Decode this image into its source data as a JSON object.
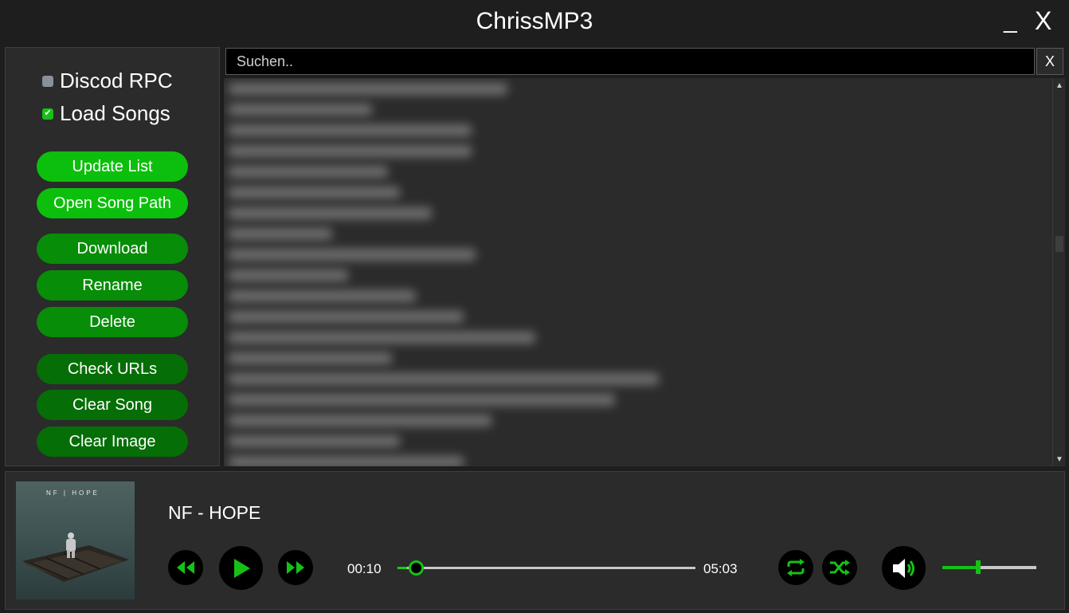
{
  "window": {
    "title": "ChrissMP3",
    "minimize_label": "_",
    "close_label": "X"
  },
  "sidebar": {
    "checkboxes": [
      {
        "label": "Discod RPC",
        "checked": false
      },
      {
        "label": "Load Songs",
        "checked": true
      }
    ],
    "buttons": [
      {
        "label": "Update List"
      },
      {
        "label": "Open Song Path"
      },
      {
        "label": "Download"
      },
      {
        "label": "Rename"
      },
      {
        "label": "Delete"
      },
      {
        "label": "Check URLs"
      },
      {
        "label": "Clear Song"
      },
      {
        "label": "Clear Image"
      }
    ]
  },
  "search": {
    "placeholder": "Suchen..",
    "value": "",
    "clear_label": "X"
  },
  "songlist": {
    "blurred": true,
    "visible_rows": 19
  },
  "player": {
    "song_title": "NF - HOPE",
    "cover_text": "NF | HOPE",
    "current_time": "00:10",
    "total_time": "05:03",
    "progress": 0.033,
    "volume": 0.38,
    "icons": {
      "previous": "rewind-icon",
      "play": "play-icon",
      "next": "fast-forward-icon",
      "repeat": "repeat-icon",
      "shuffle": "shuffle-icon",
      "volume": "speaker-icon"
    }
  },
  "colors": {
    "accent": "#16c116",
    "button_light": "#0cbf0c",
    "button_mid": "#078d07",
    "button_dark": "#066e06",
    "background": "#1e1e1e",
    "panel": "#2b2b2b"
  }
}
